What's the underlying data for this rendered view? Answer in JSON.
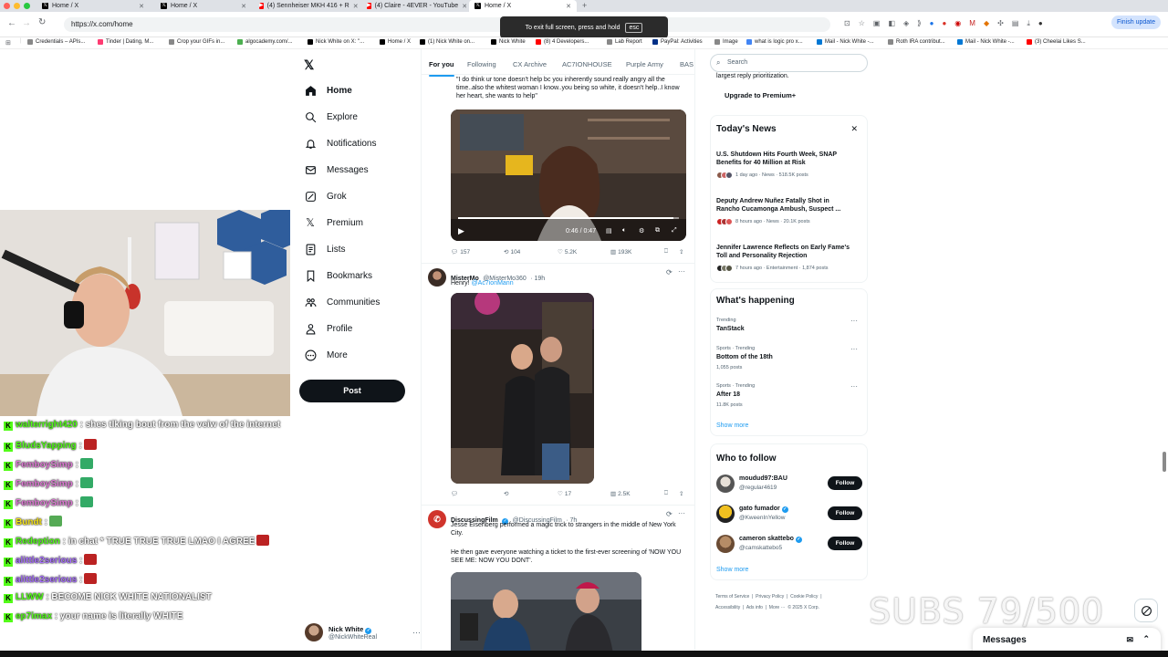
{
  "browser": {
    "tabs": [
      {
        "label": "Home / X",
        "active": false
      },
      {
        "label": "Home / X",
        "active": false
      },
      {
        "label": "(4) Sennheiser MKH 416 + R",
        "active": false
      },
      {
        "label": "(4) Claire - 4EVER - YouTube",
        "active": false
      },
      {
        "label": "Home / X",
        "active": true
      }
    ],
    "new_tab": "+",
    "url": "https://x.com/home",
    "update_button": "Finish update",
    "fullscreen_toast": {
      "text": "To exit full screen, press and hold",
      "key": "esc"
    },
    "bookmarks": [
      "Credentials – APIs...",
      "Tinder | Dating, M...",
      "Crop your GIFs in...",
      "algocademy.com/...",
      "Nick White on X: \"...",
      "Home / X",
      "(1) Nick White on...",
      "Nick White",
      "(8) 4 Developers...",
      "Lab Report",
      "PayPal: Activities",
      "Image",
      "what is logic pro x...",
      "Mail - Nick White -...",
      "Roth IRA contribut...",
      "Mail - Nick White -...",
      "(3) Cheelai Likes S..."
    ]
  },
  "nav": {
    "items": [
      {
        "label": "Home",
        "icon": "home-icon"
      },
      {
        "label": "Explore",
        "icon": "search-icon"
      },
      {
        "label": "Notifications",
        "icon": "bell-icon"
      },
      {
        "label": "Messages",
        "icon": "mail-icon"
      },
      {
        "label": "Grok",
        "icon": "grok-icon"
      },
      {
        "label": "Premium",
        "icon": "x-logo-icon"
      },
      {
        "label": "Lists",
        "icon": "list-icon"
      },
      {
        "label": "Bookmarks",
        "icon": "bookmark-icon"
      },
      {
        "label": "Communities",
        "icon": "people-icon"
      },
      {
        "label": "Profile",
        "icon": "person-icon"
      },
      {
        "label": "More",
        "icon": "more-circle-icon"
      }
    ],
    "post_button": "Post",
    "account": {
      "name": "Nick White",
      "handle": "@NickWhiteReal"
    }
  },
  "chat": [
    {
      "user": "walterright420",
      "color": "#53fc18",
      "message": ": shes tlking bout from the veiw of the internet",
      "emote": ""
    },
    {
      "user": "BludsYapping",
      "color": "#53fc18",
      "message": ":",
      "emote": "#b22"
    },
    {
      "user": "FemboySimp",
      "color": "#e07bd6",
      "message": ":",
      "emote": "#3a6"
    },
    {
      "user": "FemboySimp",
      "color": "#e07bd6",
      "message": ":",
      "emote": "#3a6"
    },
    {
      "user": "FemboySimp",
      "color": "#e07bd6",
      "message": ":",
      "emote": "#3a6"
    },
    {
      "user": "Bundt",
      "color": "#f5e31a",
      "message": ":",
      "emote": "#5a5"
    },
    {
      "user": "Redeption",
      "color": "#53fc18",
      "message": ": in chat * TRUE TRUE TRUE LMAO I AGREE",
      "emote": "#b22"
    },
    {
      "user": "alittle2serious",
      "color": "#a970ff",
      "message": ":",
      "emote": "#b22"
    },
    {
      "user": "alittle2serious",
      "color": "#a970ff",
      "message": ":",
      "emote": "#b22"
    },
    {
      "user": "LLWW",
      "color": "#53fc18",
      "message": ": BECOME NICK WHITE NATIONALIST",
      "emote": ""
    },
    {
      "user": "ep7imax",
      "color": "#53fc18",
      "message": ": your name is literally WHITE",
      "emote": ""
    }
  ],
  "feed": {
    "tabs": [
      "For you",
      "Following",
      "CX Archive",
      "AC7IONHOUSE",
      "Purple Army",
      "BAS"
    ],
    "tweet1": {
      "text": "\"I do think ur tone doesn't help bc you inherently sound really angry all the time..also the whitest woman I know..you being so white, it doesn't help..I know her heart, she wants to help\"",
      "video_time": "0:46 / 0:47",
      "replies": "157",
      "reposts": "104",
      "likes": "5.2K",
      "views": "193K"
    },
    "tweet2": {
      "name": "MisterMo",
      "handle": "@MisterMo360",
      "time": "· 19h",
      "text": "Henry!",
      "mention": "@Ac7ionMann",
      "replies": "",
      "reposts": "",
      "likes": "17",
      "views": "2.5K"
    },
    "tweet3": {
      "name": "DiscussingFilm",
      "handle": "@DiscussingFilm",
      "time": "· 7h",
      "text": "Jesse Eisenberg performed a magic trick to strangers in the middle of New York City.",
      "text2": "He then gave everyone watching a ticket to the first-ever screening of 'NOW YOU SEE ME: NOW YOU DONT'."
    }
  },
  "sidebar": {
    "search_placeholder": "Search",
    "premium_tail": "largest reply prioritization.",
    "upgrade_button": "Upgrade to Premium+",
    "news": {
      "title": "Today's News",
      "items": [
        {
          "headline": "U.S. Shutdown Hits Fourth Week, SNAP Benefits for 40 Million at Risk",
          "meta": "1 day ago · News · 518.5K posts"
        },
        {
          "headline": "Deputy Andrew Nuñez Fatally Shot in Rancho Cucamonga Ambush, Suspect ...",
          "meta": "8 hours ago · News · 20.1K posts"
        },
        {
          "headline": "Jennifer Lawrence Reflects on Early Fame's Toll and Personality Rejection",
          "meta": "7 hours ago · Entertainment · 1,874 posts"
        }
      ]
    },
    "happening": {
      "title": "What's happening",
      "items": [
        {
          "meta": "Trending",
          "name": "TanStack",
          "count": ""
        },
        {
          "meta": "Sports · Trending",
          "name": "Bottom of the 18th",
          "count": "1,055 posts"
        },
        {
          "meta": "Sports · Trending",
          "name": "After 18",
          "count": "11.8K posts"
        }
      ],
      "show_more": "Show more"
    },
    "follow": {
      "title": "Who to follow",
      "items": [
        {
          "name": "moudud97:BAU",
          "handle": "@regular4619",
          "verified": false,
          "button": "Follow"
        },
        {
          "name": "gato fumador",
          "handle": "@KweenInYellow",
          "verified": true,
          "button": "Follow"
        },
        {
          "name": "cameron skattebo",
          "handle": "@camskattebo5",
          "verified": true,
          "button": "Follow"
        }
      ],
      "show_more": "Show more"
    },
    "footer": [
      "Terms of Service",
      "|",
      "Privacy Policy",
      "|",
      "Cookie Policy",
      "|",
      "Accessibility",
      "|",
      "Ads info",
      "|",
      "More ···",
      "© 2025 X Corp."
    ]
  },
  "overlay": {
    "subs": "SUBS 79/500"
  },
  "messages_drawer": {
    "title": "Messages"
  }
}
